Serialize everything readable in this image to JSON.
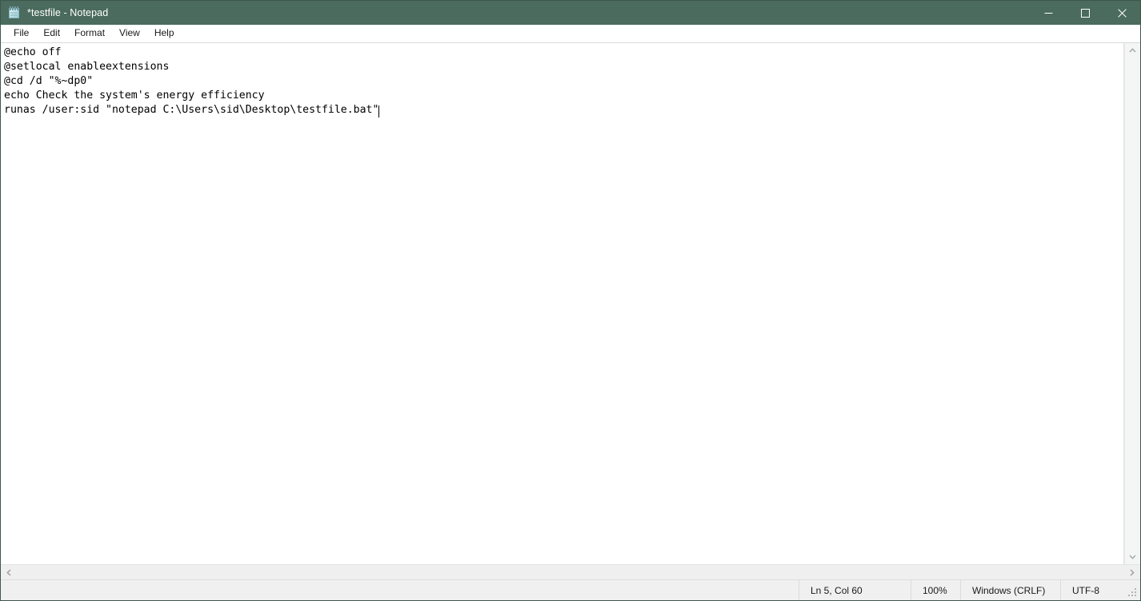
{
  "window": {
    "title": "*testfile - Notepad",
    "icon": "notepad-icon",
    "titlebar_color": "#4a6b5e",
    "title_text_color": "#ffffff"
  },
  "caption_buttons": [
    {
      "name": "minimize",
      "glyph": "minimize-icon",
      "label": "Minimize"
    },
    {
      "name": "maximize",
      "glyph": "maximize-icon",
      "label": "Maximize"
    },
    {
      "name": "close",
      "glyph": "close-icon",
      "label": "Close"
    }
  ],
  "menubar": {
    "items": [
      {
        "label": "File"
      },
      {
        "label": "Edit"
      },
      {
        "label": "Format"
      },
      {
        "label": "View"
      },
      {
        "label": "Help"
      }
    ]
  },
  "editor": {
    "content": "@echo off\n@setlocal enableextensions\n@cd /d \"%~dp0\"\necho Check the system's energy efficiency\nrunas /user:sid \"notepad C:\\Users\\sid\\Desktop\\testfile.bat\"",
    "lines": [
      "@echo off",
      "@setlocal enableextensions",
      "@cd /d \"%~dp0\"",
      "echo Check the system's energy efficiency",
      "runas /user:sid \"notepad C:\\Users\\sid\\Desktop\\testfile.bat\""
    ],
    "caret_visible": true,
    "text_color": "#000000",
    "background_color": "#ffffff"
  },
  "scrollbars": {
    "vertical": {
      "up_arrow": "chevron-up-icon",
      "down_arrow": "chevron-down-icon"
    },
    "horizontal": {
      "left_arrow": "chevron-left-icon",
      "right_arrow": "chevron-right-icon"
    }
  },
  "statusbar": {
    "cursor_position": "Ln 5, Col 60",
    "zoom": "100%",
    "line_ending": "Windows (CRLF)",
    "encoding": "UTF-8"
  }
}
